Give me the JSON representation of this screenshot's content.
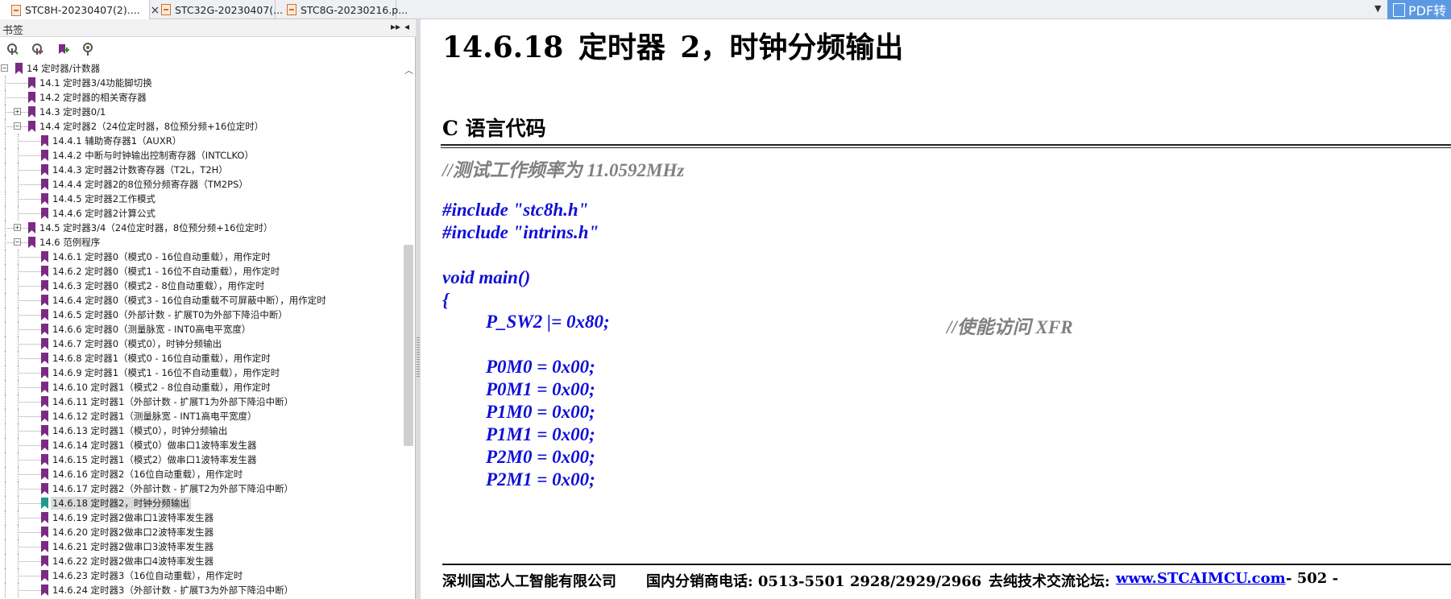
{
  "tabs": [
    {
      "label": "STC8H-20230407(2)....",
      "close": "×"
    },
    {
      "label": "STC32G-20230407(..."
    },
    {
      "label": "STC8G-20230216.p..."
    }
  ],
  "tab_overflow": "▼",
  "pdf_button": "PDF转",
  "sidebar": {
    "title": "书签",
    "collapse": "▸▸",
    "close": "◂",
    "scroll_up": "︿",
    "tree": [
      {
        "label": "14 定时器/计数器",
        "level": 0,
        "expander": "−"
      },
      {
        "label": "14.1 定时器3/4功能脚切换",
        "level": 1
      },
      {
        "label": "14.2 定时器的相关寄存器",
        "level": 1
      },
      {
        "label": "14.3 定时器0/1",
        "level": 1,
        "expander": "+"
      },
      {
        "label": "14.4 定时器2（24位定时器，8位预分频+16位定时）",
        "level": 1,
        "expander": "−"
      },
      {
        "label": "14.4.1 辅助寄存器1（AUXR）",
        "level": 2
      },
      {
        "label": "14.4.2 中断与时钟输出控制寄存器（INTCLKO）",
        "level": 2
      },
      {
        "label": "14.4.3 定时器2计数寄存器（T2L，T2H）",
        "level": 2
      },
      {
        "label": "14.4.4 定时器2的8位预分频寄存器（TM2PS）",
        "level": 2
      },
      {
        "label": "14.4.5 定时器2工作模式",
        "level": 2
      },
      {
        "label": "14.4.6 定时器2计算公式",
        "level": 2
      },
      {
        "label": "14.5 定时器3/4（24位定时器，8位预分频+16位定时）",
        "level": 1,
        "expander": "+"
      },
      {
        "label": "14.6 范例程序",
        "level": 1,
        "expander": "−"
      },
      {
        "label": "14.6.1 定时器0（模式0 - 16位自动重载），用作定时",
        "level": 2
      },
      {
        "label": "14.6.2 定时器0（模式1 - 16位不自动重载），用作定时",
        "level": 2
      },
      {
        "label": "14.6.3 定时器0（模式2 - 8位自动重载），用作定时",
        "level": 2
      },
      {
        "label": "14.6.4 定时器0（模式3 - 16位自动重载不可屏蔽中断），用作定时",
        "level": 2
      },
      {
        "label": "14.6.5 定时器0（外部计数 - 扩展T0为外部下降沿中断）",
        "level": 2
      },
      {
        "label": "14.6.6 定时器0（测量脉宽 - INT0高电平宽度）",
        "level": 2
      },
      {
        "label": "14.6.7 定时器0（模式0），时钟分频输出",
        "level": 2
      },
      {
        "label": "14.6.8 定时器1（模式0 - 16位自动重载），用作定时",
        "level": 2
      },
      {
        "label": "14.6.9 定时器1（模式1 - 16位不自动重载），用作定时",
        "level": 2
      },
      {
        "label": "14.6.10 定时器1（模式2 - 8位自动重载），用作定时",
        "level": 2
      },
      {
        "label": "14.6.11 定时器1（外部计数 - 扩展T1为外部下降沿中断）",
        "level": 2
      },
      {
        "label": "14.6.12 定时器1（测量脉宽 - INT1高电平宽度）",
        "level": 2
      },
      {
        "label": "14.6.13 定时器1（模式0），时钟分频输出",
        "level": 2
      },
      {
        "label": "14.6.14 定时器1（模式0）做串口1波特率发生器",
        "level": 2
      },
      {
        "label": "14.6.15 定时器1（模式2）做串口1波特率发生器",
        "level": 2
      },
      {
        "label": "14.6.16 定时器2（16位自动重载），用作定时",
        "level": 2
      },
      {
        "label": "14.6.17 定时器2（外部计数 - 扩展T2为外部下降沿中断）",
        "level": 2
      },
      {
        "label": "14.6.18 定时器2，时钟分频输出",
        "level": 2,
        "selected": true
      },
      {
        "label": "14.6.19 定时器2做串口1波特率发生器",
        "level": 2
      },
      {
        "label": "14.6.20 定时器2做串口2波特率发生器",
        "level": 2
      },
      {
        "label": "14.6.21 定时器2做串口3波特率发生器",
        "level": 2
      },
      {
        "label": "14.6.22 定时器2做串口4波特率发生器",
        "level": 2
      },
      {
        "label": "14.6.23 定时器3（16位自动重载），用作定时",
        "level": 2
      },
      {
        "label": "14.6.24 定时器3（外部计数 - 扩展T3为外部下降沿中断）",
        "level": 2
      }
    ]
  },
  "document": {
    "section_heading": "14.6.18   定时器 2，时钟分频输出",
    "subheading": "C 语言代码",
    "code": {
      "freq_comment": "//测试工作频率为 11.0592MHz",
      "include1": "#include \"stc8h.h\"",
      "include2": "#include \"intrins.h\"",
      "main_decl": "void main()",
      "open_brace": "{",
      "psw2": "P_SW2 |= 0x80;",
      "psw2_comment": "//使能访问 XFR",
      "p0m0": "P0M0 = 0x00;",
      "p0m1": "P0M1 = 0x00;",
      "p1m0": "P1M0 = 0x00;",
      "p1m1": "P1M1 = 0x00;",
      "p2m0": "P2M0 = 0x00;",
      "p2m1": "P2M1 = 0x00;"
    },
    "footer": {
      "company": "深圳国芯人工智能有限公司",
      "phone": "国内分销商电话: 0513-5501 2928/2929/2966",
      "forum_label": "去纯技术交流论坛:",
      "forum_link": "www.STCAIMCU.com",
      "page": "- 502 -"
    }
  }
}
